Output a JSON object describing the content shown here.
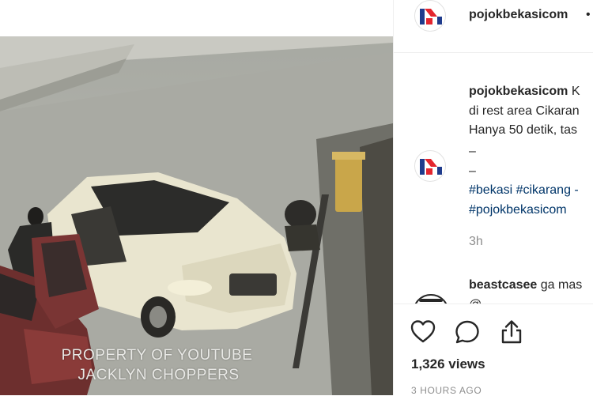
{
  "post": {
    "username": "pojokbekasicom",
    "header_dot": "•"
  },
  "video": {
    "watermark_line1": "PROPERTY OF YOUTUBE",
    "watermark_line2": "JACKLYN CHOPPERS"
  },
  "caption": {
    "username": "pojokbekasicom",
    "line1_rest": " K",
    "line2": "di rest area Cikaran",
    "line3": "Hanya 50 detik, tas",
    "dash1": "–",
    "dash2": "–",
    "hashtags_line1": "#bekasi #cikarang -",
    "hashtags_line2": "#pojokbekasicom",
    "time_ago": "3h"
  },
  "comment": {
    "username": "beastcasee",
    "text": " ga mas",
    "cut_text": "@"
  },
  "actions": {
    "like_icon": "heart-icon",
    "comment_icon": "comment-icon",
    "share_icon": "share-icon",
    "views": "1,326 views",
    "post_time": "3 HOURS AGO"
  },
  "colors": {
    "text": "#262626",
    "muted": "#8e8e8e",
    "hashtag": "#003569",
    "border": "#efefef",
    "logo_red": "#e4262f",
    "logo_blue": "#1f3b8c"
  }
}
